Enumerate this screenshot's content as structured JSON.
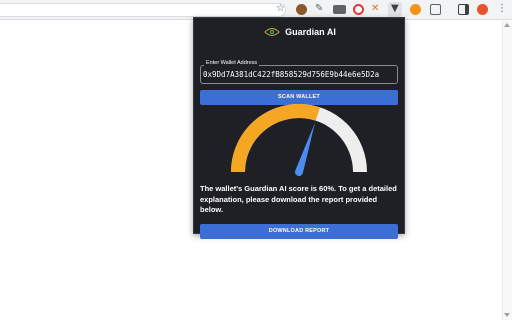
{
  "extension": {
    "title": "Guardian AI",
    "wallet_field_label": "Enter Wallet Address",
    "wallet_address": "0x9Dd7A381dC422fB858529d756E9b44e6e5D2a",
    "scan_button_label": "SCAN WALLET",
    "score_percent": 60,
    "score_message": "The wallet's Guardian AI score is 60%. To get a detailed explanation, please download the report provided below.",
    "download_button_label": "DOWNLOAD REPORT",
    "colors": {
      "popup_bg": "#1f1f26",
      "button": "#3b6fd6",
      "gauge_fill": "#f5a623",
      "gauge_track": "#eeeeee",
      "needle": "#4a8cf0"
    }
  },
  "toolbar_icons": [
    "extension-icon",
    "eyedropper-icon",
    "translate-icon",
    "opera-icon",
    "tools-icon",
    "guardian-icon",
    "bitcoin-icon",
    "puzzle-icon",
    "sidebar-icon",
    "profile-icon",
    "menu-icon"
  ]
}
